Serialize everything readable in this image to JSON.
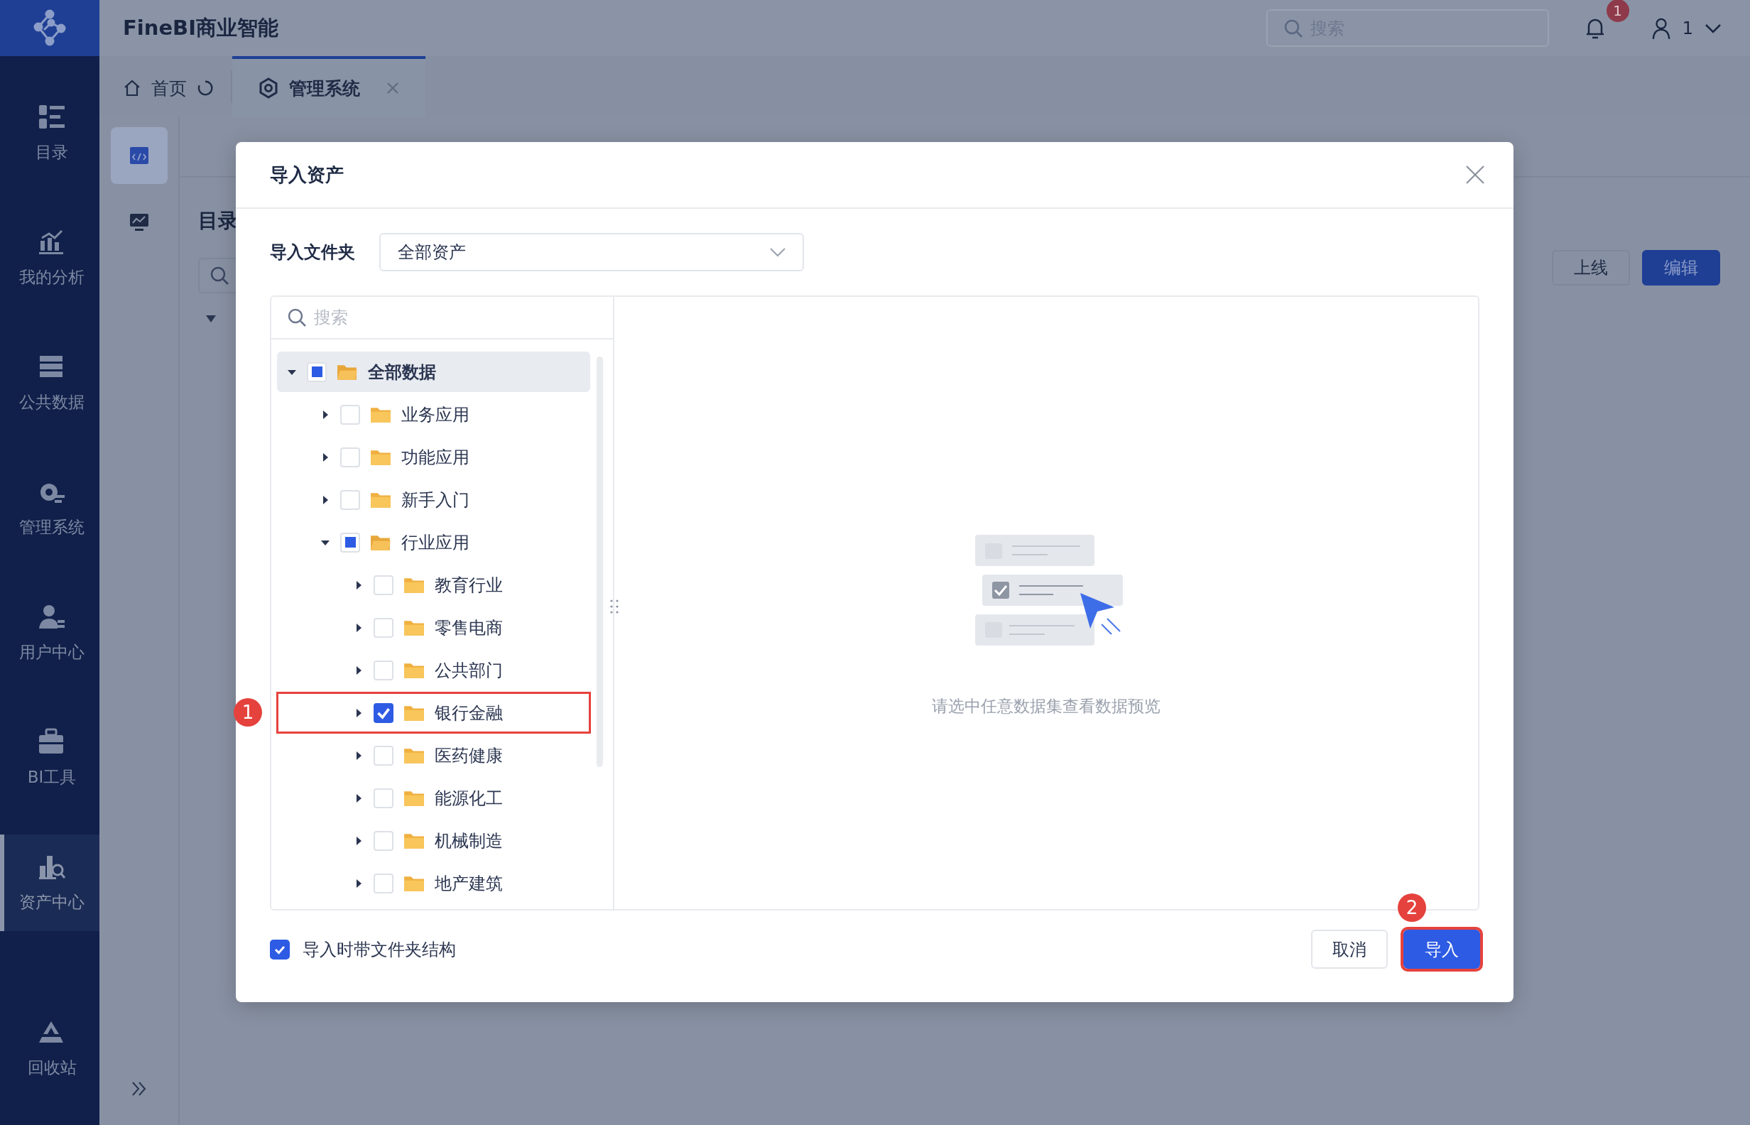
{
  "app": {
    "title": "FineBI商业智能"
  },
  "top_bar": {
    "search": {
      "placeholder": "搜索"
    },
    "notifications": "1",
    "user": "1"
  },
  "sidebar": {
    "items": [
      {
        "label": "目录",
        "selected": false
      },
      {
        "label": "我的分析",
        "selected": false
      },
      {
        "label": "公共数据",
        "selected": false
      },
      {
        "label": "管理系统",
        "selected": false
      },
      {
        "label": "用户中心",
        "selected": false
      },
      {
        "label": "BI工具",
        "selected": false
      },
      {
        "label": "资产中心",
        "selected": true
      },
      {
        "label": "回收站",
        "selected": false
      }
    ]
  },
  "tabs": [
    {
      "label": "首页",
      "selected": false,
      "kind": "home"
    },
    {
      "label": "管理系统",
      "selected": true,
      "kind": "closable"
    }
  ],
  "sub_panel": {
    "items": [
      {
        "selected": true
      },
      {
        "selected": false
      }
    ]
  },
  "content": {
    "heading": "目录",
    "buttons": [
      "上线",
      "编辑"
    ]
  },
  "dialog": {
    "title": "导入资产",
    "folder": {
      "label": "导入文件夹",
      "value": "全部资产"
    },
    "tree_search": {
      "placeholder": "搜索"
    },
    "tree": [
      {
        "label": "全部数据",
        "checked": false,
        "partial": true,
        "expanded": true,
        "selected": true,
        "children": [
          {
            "label": "业务应用",
            "checked": false,
            "partial": false,
            "expanded": false,
            "selected": false
          },
          {
            "label": "功能应用",
            "checked": false,
            "partial": false,
            "expanded": false,
            "selected": false
          },
          {
            "label": "新手入门",
            "checked": false,
            "partial": false,
            "expanded": false,
            "selected": false
          },
          {
            "label": "行业应用",
            "checked": false,
            "partial": true,
            "expanded": true,
            "selected": false,
            "children": [
              {
                "label": "教育行业",
                "checked": false,
                "partial": false,
                "expanded": false,
                "selected": false
              },
              {
                "label": "零售电商",
                "checked": false,
                "partial": false,
                "expanded": false,
                "selected": false
              },
              {
                "label": "公共部门",
                "checked": false,
                "partial": false,
                "expanded": false,
                "selected": false
              },
              {
                "label": "银行金融",
                "checked": true,
                "partial": false,
                "expanded": false,
                "selected": false,
                "callout": "1"
              },
              {
                "label": "医药健康",
                "checked": false,
                "partial": false,
                "expanded": false,
                "selected": false
              },
              {
                "label": "能源化工",
                "checked": false,
                "partial": false,
                "expanded": false,
                "selected": false
              },
              {
                "label": "机械制造",
                "checked": false,
                "partial": false,
                "expanded": false,
                "selected": false
              },
              {
                "label": "地产建筑",
                "checked": false,
                "partial": false,
                "expanded": false,
                "selected": false
              }
            ]
          }
        ]
      }
    ],
    "preview_hint": "请选中任意数据集查看数据预览",
    "keep_structure": {
      "label": "导入时带文件夹结构",
      "checked": true
    },
    "cancel": "取消",
    "confirm": {
      "label": "导入",
      "callout": "2"
    }
  }
}
